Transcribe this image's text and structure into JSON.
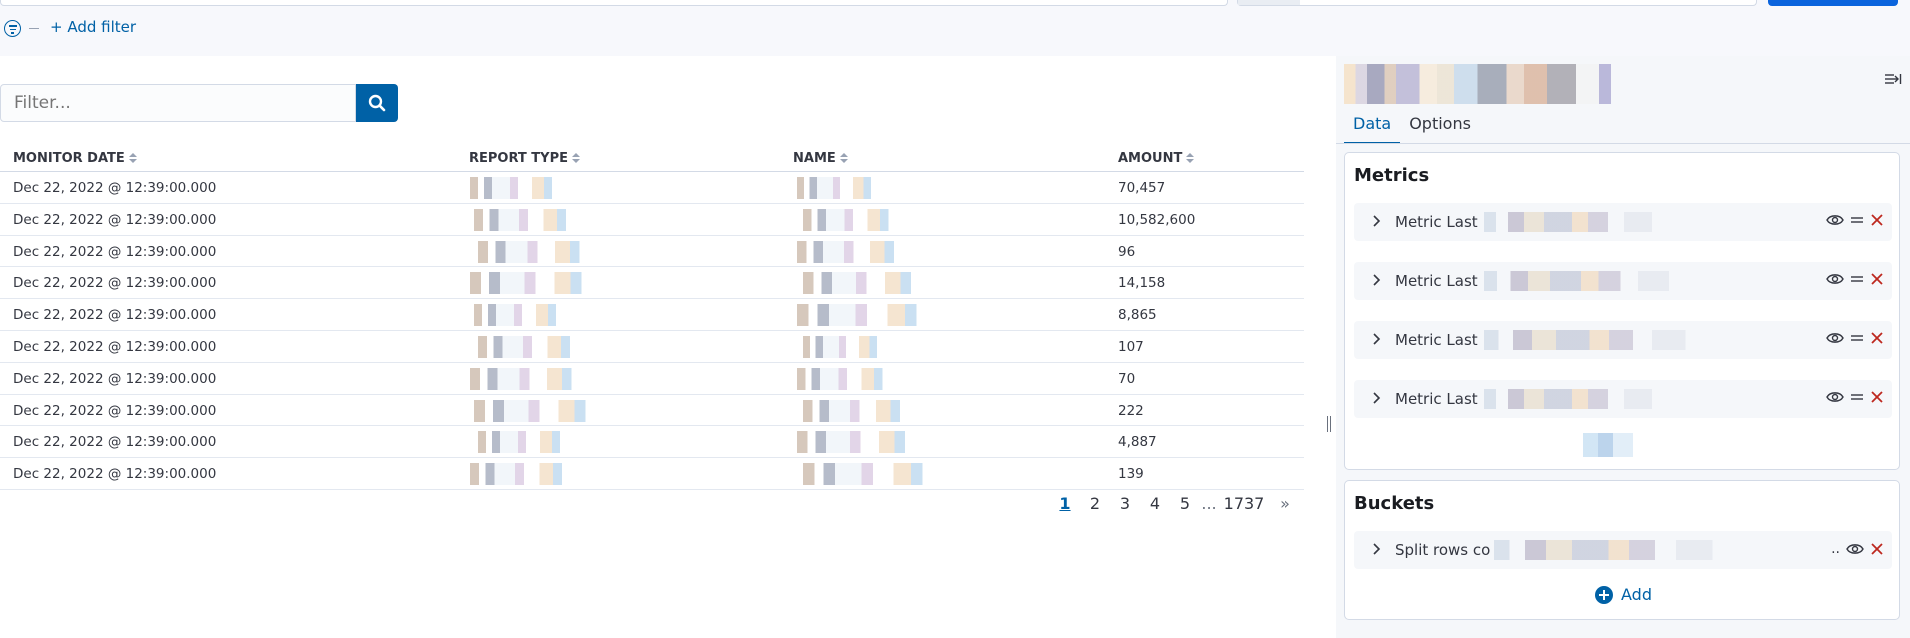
{
  "topbar": {
    "add_filter_label": "+ Add filter"
  },
  "search": {
    "placeholder": "Filter..."
  },
  "table": {
    "columns": [
      "MONITOR DATE",
      "REPORT TYPE",
      "NAME",
      "AMOUNT"
    ],
    "rows": [
      {
        "date": "Dec 22, 2022 @ 12:39:00.000",
        "amount": "70,457"
      },
      {
        "date": "Dec 22, 2022 @ 12:39:00.000",
        "amount": "10,582,600"
      },
      {
        "date": "Dec 22, 2022 @ 12:39:00.000",
        "amount": "96"
      },
      {
        "date": "Dec 22, 2022 @ 12:39:00.000",
        "amount": "14,158"
      },
      {
        "date": "Dec 22, 2022 @ 12:39:00.000",
        "amount": "8,865"
      },
      {
        "date": "Dec 22, 2022 @ 12:39:00.000",
        "amount": "107"
      },
      {
        "date": "Dec 22, 2022 @ 12:39:00.000",
        "amount": "70"
      },
      {
        "date": "Dec 22, 2022 @ 12:39:00.000",
        "amount": "222"
      },
      {
        "date": "Dec 22, 2022 @ 12:39:00.000",
        "amount": "4,887"
      },
      {
        "date": "Dec 22, 2022 @ 12:39:00.000",
        "amount": "139"
      }
    ]
  },
  "pagination": {
    "pages": [
      "1",
      "2",
      "3",
      "4",
      "5"
    ],
    "ellipsis": "...",
    "last": "1737",
    "next": "»",
    "current": "1"
  },
  "sidebar": {
    "tabs": [
      "Data",
      "Options"
    ],
    "metrics_title": "Metrics",
    "metrics": [
      {
        "label": "Metric Last"
      },
      {
        "label": "Metric Last"
      },
      {
        "label": "Metric Last"
      },
      {
        "label": "Metric Last"
      }
    ],
    "buckets_title": "Buckets",
    "buckets": [
      {
        "label": "Split rows co",
        "suffix": ".."
      }
    ],
    "add_label": "Add"
  },
  "colors": {
    "accent": "#0061a6",
    "danger": "#bd271e",
    "border": "#d3dae6"
  }
}
